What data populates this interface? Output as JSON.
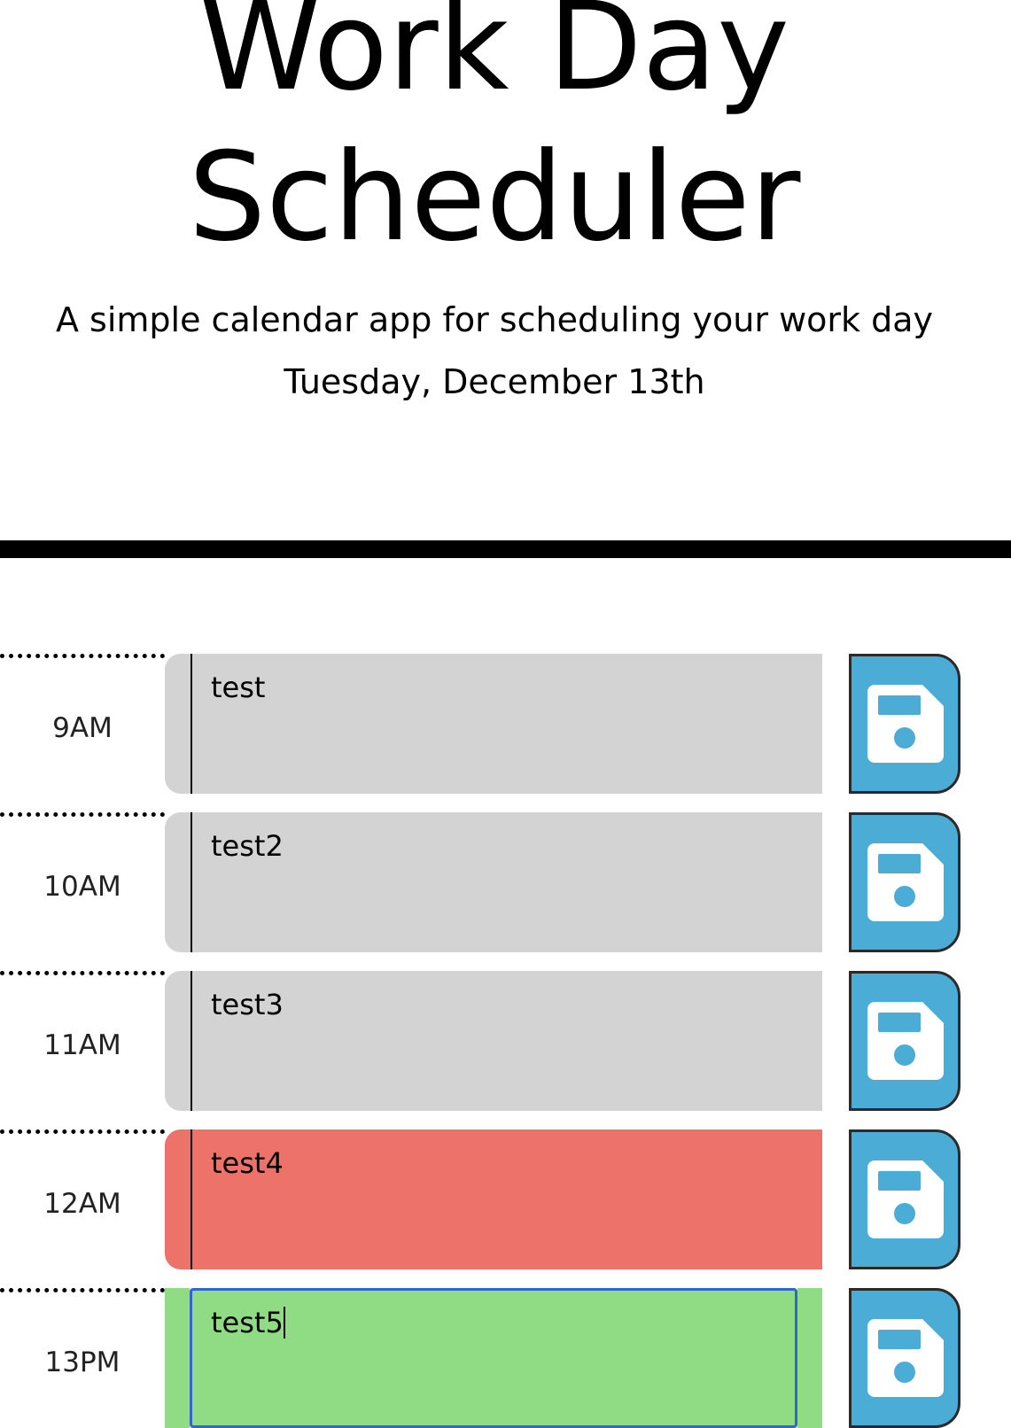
{
  "header": {
    "title_line1": "Work Day",
    "title_line2": "Scheduler",
    "lead": "A simple calendar app for scheduling your work day",
    "current_date": "Tuesday, December 13th"
  },
  "colors": {
    "past": "#d3d3d3",
    "present": "#ed7269",
    "future": "#90dc85",
    "save_button": "#4bacd6"
  },
  "time_blocks": [
    {
      "hour": "9AM",
      "text": "test",
      "state": "past"
    },
    {
      "hour": "10AM",
      "text": "test2",
      "state": "past"
    },
    {
      "hour": "11AM",
      "text": "test3",
      "state": "past"
    },
    {
      "hour": "12AM",
      "text": "test4",
      "state": "present"
    },
    {
      "hour": "13PM",
      "text": "test5",
      "state": "future",
      "focused": true
    }
  ],
  "save_icon": "floppy-disk-icon"
}
